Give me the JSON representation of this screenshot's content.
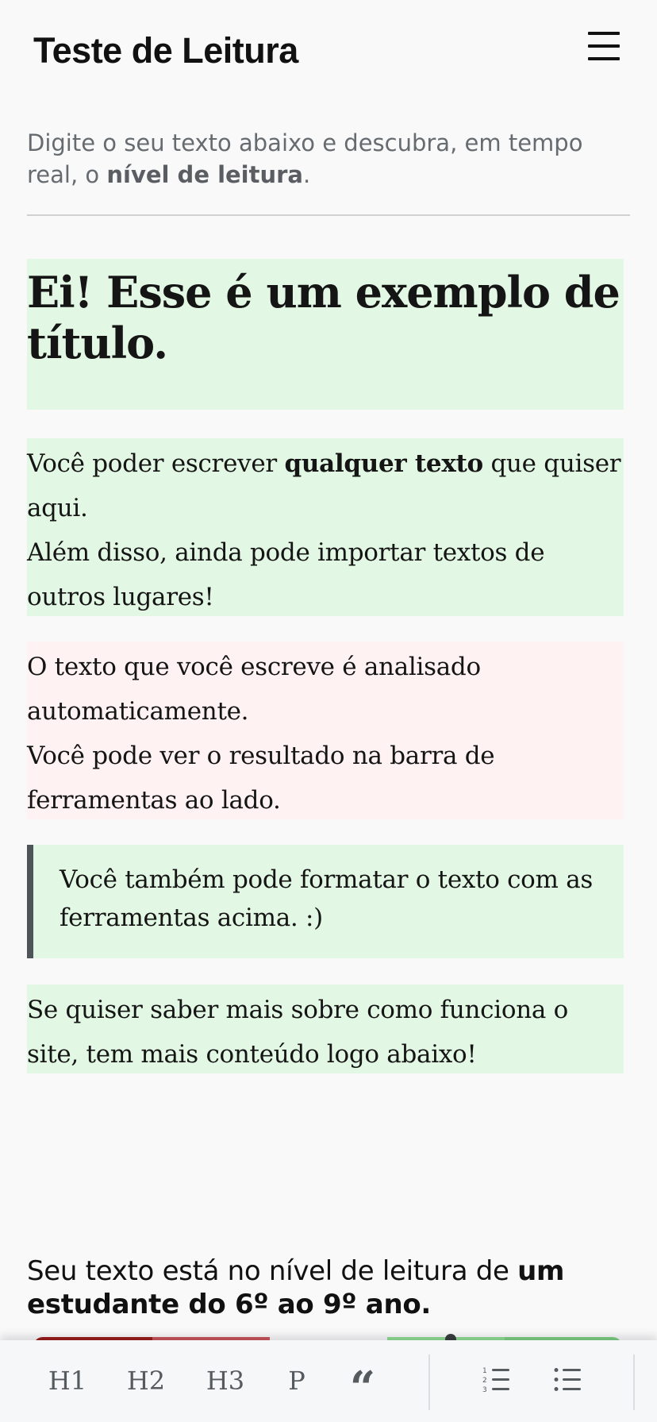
{
  "header": {
    "title": "Teste de Leitura",
    "menu_icon": "hamburger-menu-icon"
  },
  "intro": {
    "text_before": "Digite o seu texto abaixo e descubra, em tempo real, o ",
    "bold": "nível de leitura",
    "text_after": "."
  },
  "editor": {
    "heading": "Ei! Esse é um exemplo de título.",
    "p1": {
      "before": "Você poder escrever ",
      "bold": "qualquer texto",
      "after": " que quiser aqui.",
      "line2": "Além disso, ainda pode importar textos de outros lugares!"
    },
    "p2": {
      "line1": "O texto que você escreve é analisado automaticamente.",
      "line2": "Você pode ver o resultado na barra de ferramentas ao lado."
    },
    "quote": "Você também pode formatar o texto com as ferramentas acima. :)",
    "p3": "Se quiser saber mais sobre como funciona o site, tem mais conteúdo logo abaixo!"
  },
  "result": {
    "before": "Seu texto está no nível de leitura de ",
    "bold": "um estudante do 6º ao 9º ano."
  },
  "colors": {
    "ok_block": "#e3f8e4",
    "hard_block": "#fef3f2",
    "meter": [
      "#9b1c1c",
      "#c9565c",
      "#8fdd95",
      "#7ccf84"
    ]
  },
  "toolbar": {
    "h1": "H1",
    "h2": "H2",
    "h3": "H3",
    "p": "P",
    "quote": "“",
    "ordered_list_icon": "ordered-list-icon",
    "bullet_list_icon": "bullet-list-icon"
  }
}
